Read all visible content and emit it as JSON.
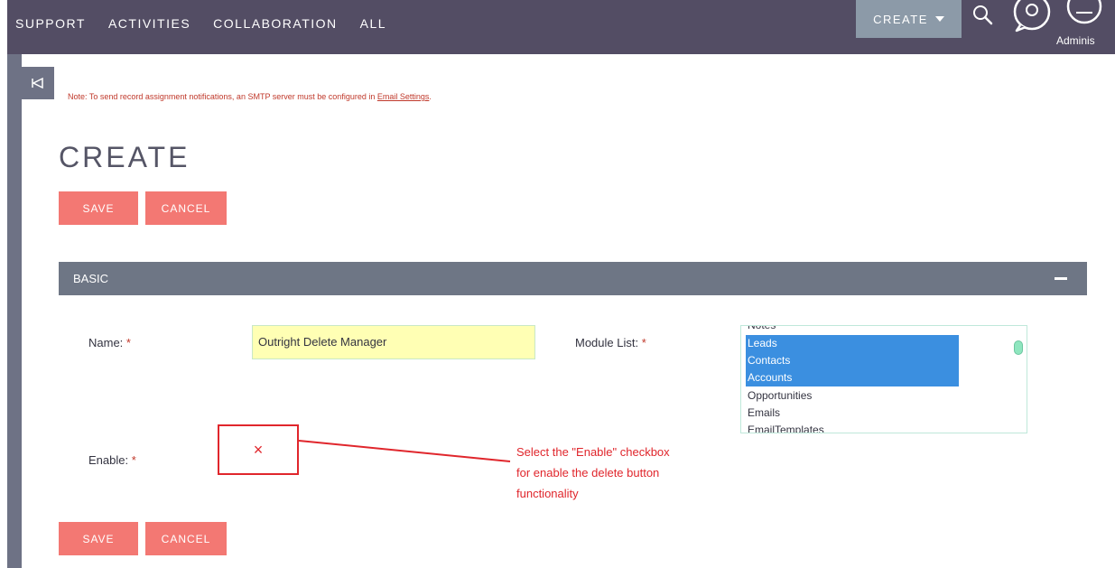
{
  "nav": {
    "items": [
      "SUPPORT",
      "ACTIVITIES",
      "COLLABORATION",
      "ALL"
    ],
    "create_label": "CREATE",
    "user_label": "Adminis"
  },
  "note": {
    "text": "Note: To send record assignment notifications, an SMTP server must be configured in ",
    "link": "Email Settings",
    "end": "."
  },
  "page": {
    "title": "CREATE"
  },
  "buttons": {
    "save": "SAVE",
    "cancel": "CANCEL"
  },
  "panel": {
    "title": "BASIC"
  },
  "form": {
    "name_label": "Name:",
    "name_value": "Outright Delete Manager",
    "module_label": "Module List:",
    "modules": [
      "Notes",
      "Leads",
      "Contacts",
      "Accounts",
      "Opportunities",
      "Emails",
      "EmailTemplates"
    ],
    "selected_modules": [
      "Leads",
      "Contacts",
      "Accounts"
    ],
    "enable_label": "Enable:",
    "enable_mark": "×",
    "required_mark": "*"
  },
  "annotation": {
    "lines": [
      "Select the \"Enable\" checkbox",
      "for enable the delete button",
      "functionality"
    ]
  },
  "colors": {
    "nav_bg": "#534d64",
    "button_bg": "#f37873",
    "panel_bg": "#6e7685",
    "selected_bg": "#3b8fe0",
    "annotation": "#e0262c",
    "required": "#c0392b"
  }
}
